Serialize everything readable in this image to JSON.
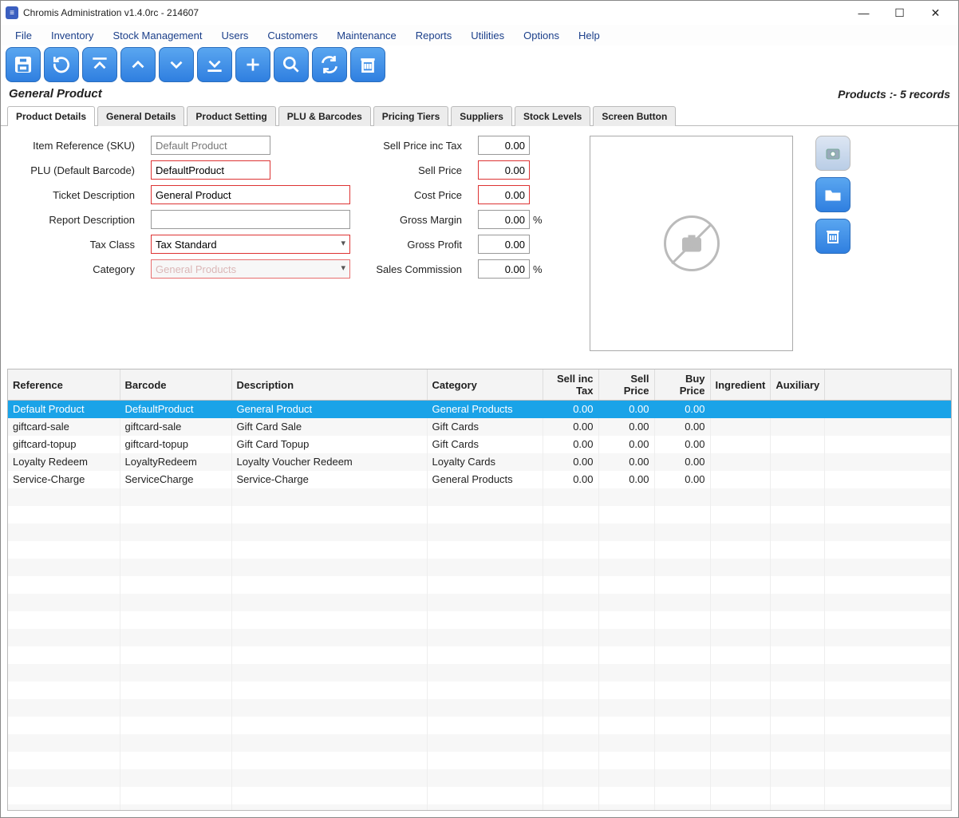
{
  "window": {
    "title": "Chromis Administration v1.4.0rc - 214607"
  },
  "menu": {
    "file": "File",
    "inventory": "Inventory",
    "stock": "Stock Management",
    "users": "Users",
    "customers": "Customers",
    "maintenance": "Maintenance",
    "reports": "Reports",
    "utilities": "Utilities",
    "options": "Options",
    "help": "Help"
  },
  "header": {
    "title": "General Product",
    "records": "Products :- 5 records"
  },
  "tabs": {
    "product_details": "Product Details",
    "general_details": "General Details",
    "product_setting": "Product Setting",
    "plu_barcodes": "PLU & Barcodes",
    "pricing_tiers": "Pricing Tiers",
    "suppliers": "Suppliers",
    "stock_levels": "Stock Levels",
    "screen_button": "Screen Button"
  },
  "labels": {
    "sku": "Item Reference (SKU)",
    "plu": "PLU (Default Barcode)",
    "ticket": "Ticket Description",
    "report": "Report Description",
    "tax": "Tax Class",
    "category": "Category",
    "sell_inc": "Sell Price inc Tax",
    "sell": "Sell Price",
    "cost": "Cost Price",
    "margin": "Gross Margin",
    "profit": "Gross Profit",
    "commission": "Sales Commission",
    "pct": "%"
  },
  "form": {
    "sku_placeholder": "Default Product",
    "plu": "DefaultProduct",
    "ticket": "General Product",
    "report": "",
    "tax": "Tax Standard",
    "category": "General Products",
    "sell_inc": "0.00",
    "sell": "0.00",
    "cost": "0.00",
    "margin": "0.00",
    "profit": "0.00",
    "commission": "0.00"
  },
  "table": {
    "headers": {
      "reference": "Reference",
      "barcode": "Barcode",
      "description": "Description",
      "category": "Category",
      "sell_inc": "Sell inc Tax",
      "sell_price": "Sell Price",
      "buy_price": "Buy Price",
      "ingredient": "Ingredient",
      "auxiliary": "Auxiliary"
    },
    "rows": [
      {
        "reference": "Default Product",
        "barcode": "DefaultProduct",
        "description": "General Product",
        "category": "General Products",
        "sell_inc": "0.00",
        "sell_price": "0.00",
        "buy_price": "0.00",
        "ingredient": "",
        "auxiliary": "",
        "selected": true
      },
      {
        "reference": "giftcard-sale",
        "barcode": "giftcard-sale",
        "description": "Gift Card Sale",
        "category": "Gift Cards",
        "sell_inc": "0.00",
        "sell_price": "0.00",
        "buy_price": "0.00",
        "ingredient": "",
        "auxiliary": ""
      },
      {
        "reference": "giftcard-topup",
        "barcode": "giftcard-topup",
        "description": "Gift Card Topup",
        "category": "Gift Cards",
        "sell_inc": "0.00",
        "sell_price": "0.00",
        "buy_price": "0.00",
        "ingredient": "",
        "auxiliary": ""
      },
      {
        "reference": "Loyalty Redeem",
        "barcode": "LoyaltyRedeem",
        "description": "Loyalty Voucher Redeem",
        "category": "Loyalty Cards",
        "sell_inc": "0.00",
        "sell_price": "0.00",
        "buy_price": "0.00",
        "ingredient": "",
        "auxiliary": ""
      },
      {
        "reference": "Service-Charge",
        "barcode": "ServiceCharge",
        "description": "Service-Charge",
        "category": "General Products",
        "sell_inc": "0.00",
        "sell_price": "0.00",
        "buy_price": "0.00",
        "ingredient": "",
        "auxiliary": ""
      }
    ]
  }
}
